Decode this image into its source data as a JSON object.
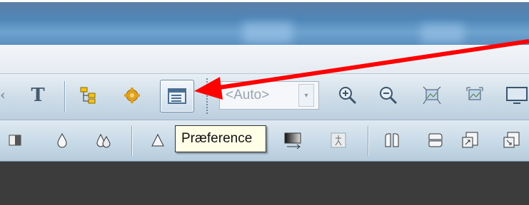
{
  "toolbar": {
    "text_tool_glyph": "T",
    "zoom_combo": {
      "value": "<Auto>",
      "dropdown_arrow": "▾"
    }
  },
  "tooltip": {
    "text": "Præference"
  },
  "annotation": {
    "arrow_color": "#ff0000",
    "points_to": "preferences-button"
  },
  "colors": {
    "toolbar_top": "#e8eff5",
    "toolbar_bottom": "#bccfdf",
    "workspace": "#3c3c3c",
    "tooltip_bg": "#fffee6"
  }
}
